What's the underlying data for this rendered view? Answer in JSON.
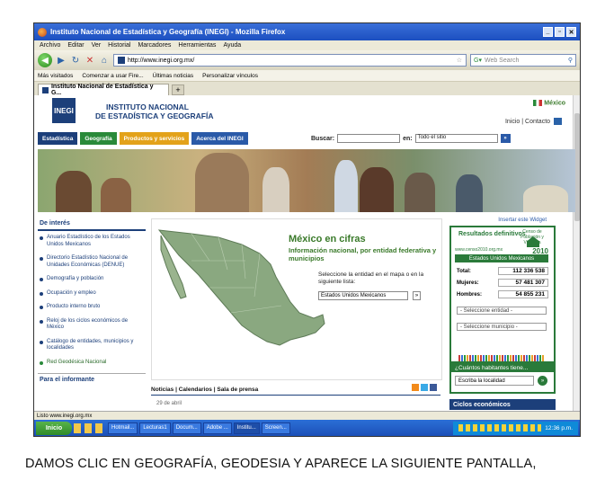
{
  "browser": {
    "title": "Instituto Nacional de Estadística y Geografía (INEGI) - Mozilla Firefox",
    "menu": [
      "Archivo",
      "Editar",
      "Ver",
      "Historial",
      "Marcadores",
      "Herramientas",
      "Ayuda"
    ],
    "url": "http://www.inegi.org.mx/",
    "search_placeholder": "Web Search",
    "bookmarks": [
      "Más visitados",
      "Comenzar a usar Fire...",
      "Últimas noticias",
      "Personalizar vínculos"
    ],
    "tab_title": "Instituto Nacional de Estadística y G...",
    "status": "Listo www.inegi.org.mx"
  },
  "page": {
    "logo": "INEGI",
    "org_line1": "INSTITUTO NACIONAL",
    "org_line2": "DE ESTADÍSTICA Y GEOGRAFÍA",
    "country": "México",
    "top_links": "Inicio | Contacto",
    "nav": [
      {
        "label": "Estadística",
        "color": "#1c3f7a"
      },
      {
        "label": "Geografía",
        "color": "#2a8a3a"
      },
      {
        "label": "Productos y servicios",
        "color": "#e3a21a"
      },
      {
        "label": "Acerca del INEGI",
        "color": "#2a5aa8"
      }
    ],
    "search_label": "Buscar:",
    "in_label": "en:",
    "search_scope": "Todo el sitio",
    "sidebar_title": "De interés",
    "sidebar_items": [
      "Anuario Estadístico de los Estados Unidos Mexicanos",
      "Directorio Estadístico Nacional de Unidades Económicas (DENUE)",
      "Demografía y población",
      "Ocupación y empleo",
      "Producto interno bruto",
      "Reloj de los ciclos económicos de México",
      "Catálogo de entidades, municipios y localidades",
      "Red Geodésica Nacional"
    ],
    "sidebar_footer": "Para el informante",
    "map_title": "México en cifras",
    "map_subtitle": "Información nacional, por entidad federativa y municipios",
    "map_text": "Seleccione la entidad en el mapa o en la siguiente lista:",
    "map_select": "Estados Unidos Mexicanos",
    "news_links": "Noticias | Calendarios | Sala de prensa",
    "news_date": "29 de abril",
    "widget_link": "Insertar este Widget",
    "censo_results": "Resultados definitivos",
    "censo_url": "www.censo2010.org.mx",
    "censo_label": "Censo de Población y Vivienda",
    "censo_year": "2010",
    "censo_header": "Estados Unidos Mexicanos",
    "total_label": "Total:",
    "total_value": "112 336 538",
    "mujeres_label": "Mujeres:",
    "mujeres_value": "57 481 307",
    "hombres_label": "Hombres:",
    "hombres_value": "54 855 231",
    "select_entidad": "- Seleccione entidad -",
    "select_municipio": "- Seleccione municipio -",
    "cuantos_title": "¿Cuántos habitantes tiene...",
    "localidad_placeholder": "Escriba la localidad",
    "ciclos_title": "Ciclos económicos"
  },
  "taskbar": {
    "start": "Inicio",
    "tasks": [
      "Hotmail...",
      "Lecturas1",
      "Docum...",
      "Adobe ...",
      "Institu...",
      "Screen..."
    ],
    "time": "12:36 p.m."
  },
  "caption": "DAMOS CLIC EN GEOGRAFÍA, GEODESIA  Y APARECE  LA SIGUIENTE PANTALLA,"
}
